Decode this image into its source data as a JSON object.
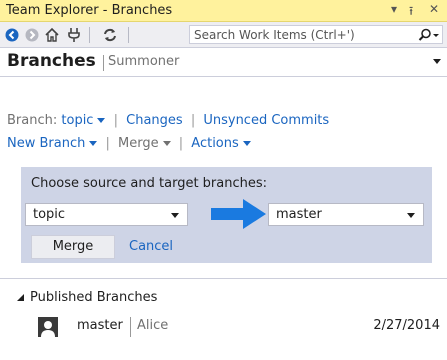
{
  "window": {
    "title": "Team Explorer - Branches",
    "controls": {
      "dropdown": "▾",
      "pin": "⭱",
      "close": "✕"
    }
  },
  "toolbar": {
    "icons": [
      "back-icon",
      "forward-icon",
      "home-icon",
      "connect-icon",
      "refresh-icon"
    ],
    "search": {
      "placeholder": "Search Work Items (Ctrl+')",
      "value": ""
    }
  },
  "page": {
    "title": "Branches",
    "subtitle": "Summoner"
  },
  "nav": {
    "branch_label": "Branch:",
    "branch_value": "topic",
    "changes": "Changes",
    "unsynced": "Unsynced Commits",
    "new_branch": "New Branch",
    "merge": "Merge",
    "actions": "Actions"
  },
  "merge_panel": {
    "heading": "Choose source and target branches:",
    "source": "topic",
    "target": "master",
    "merge_button": "Merge",
    "cancel": "Cancel",
    "arrow_color": "#1a7ae0"
  },
  "published": {
    "title": "Published Branches",
    "items": [
      {
        "name": "master",
        "author": "Alice",
        "date": "2/27/2014"
      }
    ]
  }
}
